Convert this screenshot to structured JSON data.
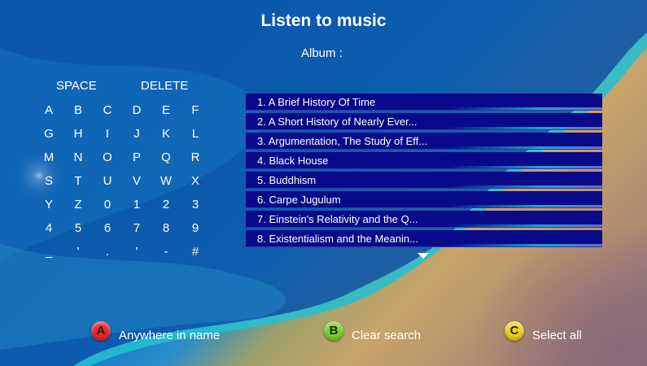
{
  "header": {
    "title": "Listen to music",
    "album_label": "Album :"
  },
  "keyboard": {
    "space_label": "SPACE",
    "delete_label": "DELETE",
    "keys": [
      "A",
      "B",
      "C",
      "D",
      "E",
      "F",
      "G",
      "H",
      "I",
      "J",
      "K",
      "L",
      "M",
      "N",
      "O",
      "P",
      "Q",
      "R",
      "S",
      "T",
      "U",
      "V",
      "W",
      "X",
      "Y",
      "Z",
      "0",
      "1",
      "2",
      "3",
      "4",
      "5",
      "6",
      "7",
      "8",
      "9",
      "_",
      "'",
      ".",
      "'",
      "-",
      "#"
    ]
  },
  "albums": [
    "1. A Brief History Of Time",
    "2. A Short History of Nearly Ever...",
    "3. Argumentation, The Study of Eff...",
    "4. Black House",
    "5. Buddhism",
    "6. Carpe Jugulum",
    "7. Einstein's Relativity and the Q...",
    "8. Existentialism and the Meanin..."
  ],
  "buttons": [
    {
      "letter": "A",
      "label": "Anywhere in name",
      "color": "#e8282e"
    },
    {
      "letter": "B",
      "label": "Clear search",
      "color": "#7ed321"
    },
    {
      "letter": "C",
      "label": "Select all",
      "color": "#f2d21b"
    }
  ],
  "colors": {
    "list_item_bg": "#080a8a",
    "accent_water": "#0a63b8"
  }
}
